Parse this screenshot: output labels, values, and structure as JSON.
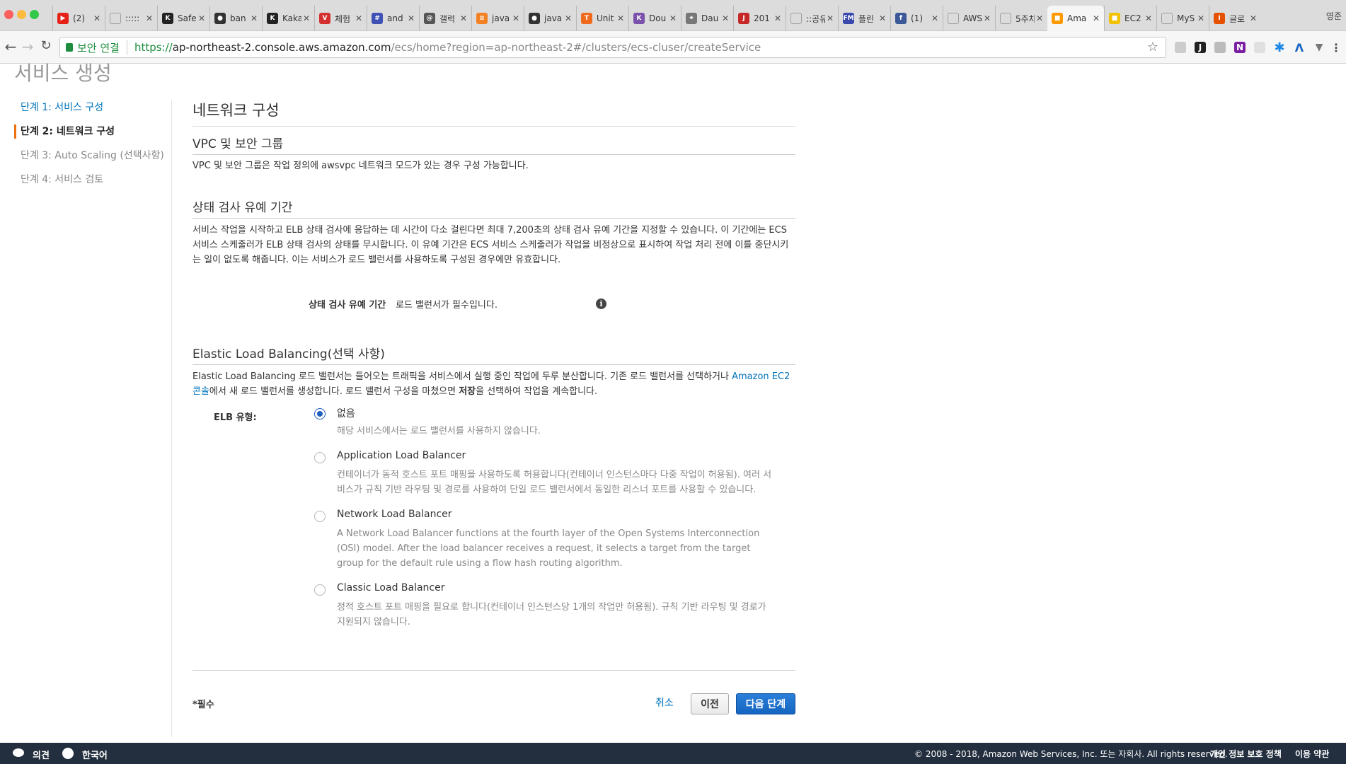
{
  "browser": {
    "tabs": [
      {
        "label": "(2)",
        "icon": "youtube-icon",
        "color": "#e62117",
        "glyph": "▶"
      },
      {
        "label": ":::::",
        "icon": "page-icon",
        "color": "#9e9e9e",
        "glyph": ""
      },
      {
        "label": "Safe",
        "icon": "kakao-icon",
        "color": "#222222",
        "glyph": "K"
      },
      {
        "label": "ban",
        "icon": "github-icon",
        "color": "#333333",
        "glyph": "●"
      },
      {
        "label": "Kaka",
        "icon": "kakao-icon",
        "color": "#222222",
        "glyph": "K"
      },
      {
        "label": "체험",
        "icon": "vivaldi-icon",
        "color": "#d32f2f",
        "glyph": "V"
      },
      {
        "label": "and",
        "icon": "hashnode-icon",
        "color": "#3f51b5",
        "glyph": "#"
      },
      {
        "label": "갤럭",
        "icon": "spiral-icon",
        "color": "#555555",
        "glyph": "@"
      },
      {
        "label": "java",
        "icon": "stackoverflow-icon",
        "color": "#f48024",
        "glyph": "≡"
      },
      {
        "label": "java",
        "icon": "github-icon",
        "color": "#333333",
        "glyph": "●"
      },
      {
        "label": "Unit",
        "icon": "tistory-icon",
        "color": "#f06a1e",
        "glyph": "T"
      },
      {
        "label": "Dou",
        "icon": "kotlin-icon",
        "color": "#7b52ab",
        "glyph": "K"
      },
      {
        "label": "Dau",
        "icon": "map-pin-icon",
        "color": "#777777",
        "glyph": "⌖"
      },
      {
        "label": "201",
        "icon": "jr-icon",
        "color": "#c62828",
        "glyph": "J"
      },
      {
        "label": "::공유",
        "icon": "page-icon",
        "color": "#9e9e9e",
        "glyph": ""
      },
      {
        "label": "플린",
        "icon": "fm-icon",
        "color": "#3949ab",
        "glyph": "FM"
      },
      {
        "label": "(1)",
        "icon": "facebook-icon",
        "color": "#3b5998",
        "glyph": "f"
      },
      {
        "label": "AWS",
        "icon": "page-icon",
        "color": "#9e9e9e",
        "glyph": ""
      },
      {
        "label": "5주차",
        "icon": "page-icon",
        "color": "#9e9e9e",
        "glyph": ""
      },
      {
        "label": "Ama",
        "icon": "aws-cube-icon",
        "color": "#f90",
        "glyph": "■",
        "active": true
      },
      {
        "label": "EC2",
        "icon": "aws-cube-icon",
        "color": "#f2c200",
        "glyph": "■"
      },
      {
        "label": "MyS",
        "icon": "page-icon",
        "color": "#9e9e9e",
        "glyph": ""
      },
      {
        "label": "글로",
        "icon": "box-icon",
        "color": "#e65100",
        "glyph": "I"
      }
    ],
    "profile_label": "영준",
    "secure_label": "보안 연결",
    "url": {
      "scheme": "https://",
      "host": "ap-northeast-2.console.aws.amazon.com",
      "path": "/ecs/home?region=ap-northeast-2#/clusters/ecs-cluser/createService"
    }
  },
  "page": {
    "title": "서비스 생성",
    "steps": [
      {
        "label": "단계 1: 서비스 구성",
        "state": "link"
      },
      {
        "label": "단계 2: 네트워크 구성",
        "state": "current"
      },
      {
        "label": "단계 3: Auto Scaling (선택사항)",
        "state": "disabled"
      },
      {
        "label": "단계 4: 서비스 검토",
        "state": "disabled"
      }
    ],
    "section_title": "네트워크 구성",
    "vpc": {
      "heading": "VPC 및 보안 그룹",
      "text": "VPC 및 보안 그룹은 작업 정의에 awsvpc 네트워크 모드가 있는 경우 구성 가능합니다."
    },
    "grace": {
      "heading": "상태 검사 유예 기간",
      "text": "서비스 작업을 시작하고 ELB 상태 검사에 응답하는 데 시간이 다소 걸린다면 최대 7,200초의 상태 검사 유예 기간을 지정할 수 있습니다. 이 기간에는 ECS 서비스 스케줄러가 ELB 상태 검사의 상태를 무시합니다. 이 유예 기간은 ECS 서비스 스케줄러가 작업을 비정상으로 표시하여 작업 처리 전에 이를 중단시키는 일이 없도록 해줍니다. 이는 서비스가 로드 밸런서를 사용하도록 구성된 경우에만 유효합니다.",
      "field_label": "상태 검사 유예 기간",
      "field_value": "로드 밸런서가 필수입니다."
    },
    "elb": {
      "heading": "Elastic Load Balancing(선택 사항)",
      "text_1": "Elastic Load Balancing 로드 밸런서는 들어오는 트래픽을 서비스에서 실행 중인 작업에 두루 분산합니다. 기존 로드 밸런서를 선택하거나 ",
      "link": "Amazon EC2 콘솔",
      "text_2": "에서 새 로드 밸런서를 생성합니다. 로드 밸런서 구성을 마쳤으면 ",
      "text_bold": "저장",
      "text_3": "을 선택하여 작업을 계속합니다.",
      "type_label": "ELB 유형:",
      "options": [
        {
          "title": "없음",
          "desc": "해당 서비스에서는 로드 밸런서를 사용하지 않습니다.",
          "checked": true
        },
        {
          "title": "Application Load Balancer",
          "desc": "컨테이너가 동적 호스트 포트 매핑을 사용하도록 허용합니다(컨테이너 인스턴스마다 다중 작업이 허용됨). 여러 서비스가 규칙 기반 라우팅 및 경로를 사용하여 단일 로드 밸런서에서 동일한 리스너 포트를 사용할 수 있습니다.",
          "checked": false
        },
        {
          "title": "Network Load Balancer",
          "desc": "A Network Load Balancer functions at the fourth layer of the Open Systems Interconnection (OSI) model. After the load balancer receives a request, it selects a target from the target group for the default rule using a flow hash routing algorithm.",
          "checked": false
        },
        {
          "title": "Classic Load Balancer",
          "desc": "정적 호스트 포트 매핑을 필요로 합니다(컨테이너 인스턴스당 1개의 작업만 허용됨). 규칙 기반 라우팅 및 경로가 지원되지 않습니다.",
          "checked": false
        }
      ]
    },
    "required_note": "*필수",
    "buttons": {
      "cancel": "취소",
      "prev": "이전",
      "next": "다음 단계"
    }
  },
  "footer": {
    "feedback": "의견",
    "language": "한국어",
    "copyright": "© 2008 - 2018, Amazon Web Services, Inc. 또는 자회사. All rights reserved.",
    "privacy": "개인 정보 보호 정책",
    "terms": "이용 약관"
  },
  "colors": {
    "accent": "#ec7211",
    "link": "#0073bb",
    "primary_button": "#1565c0",
    "footer_bg": "#232f3e"
  }
}
